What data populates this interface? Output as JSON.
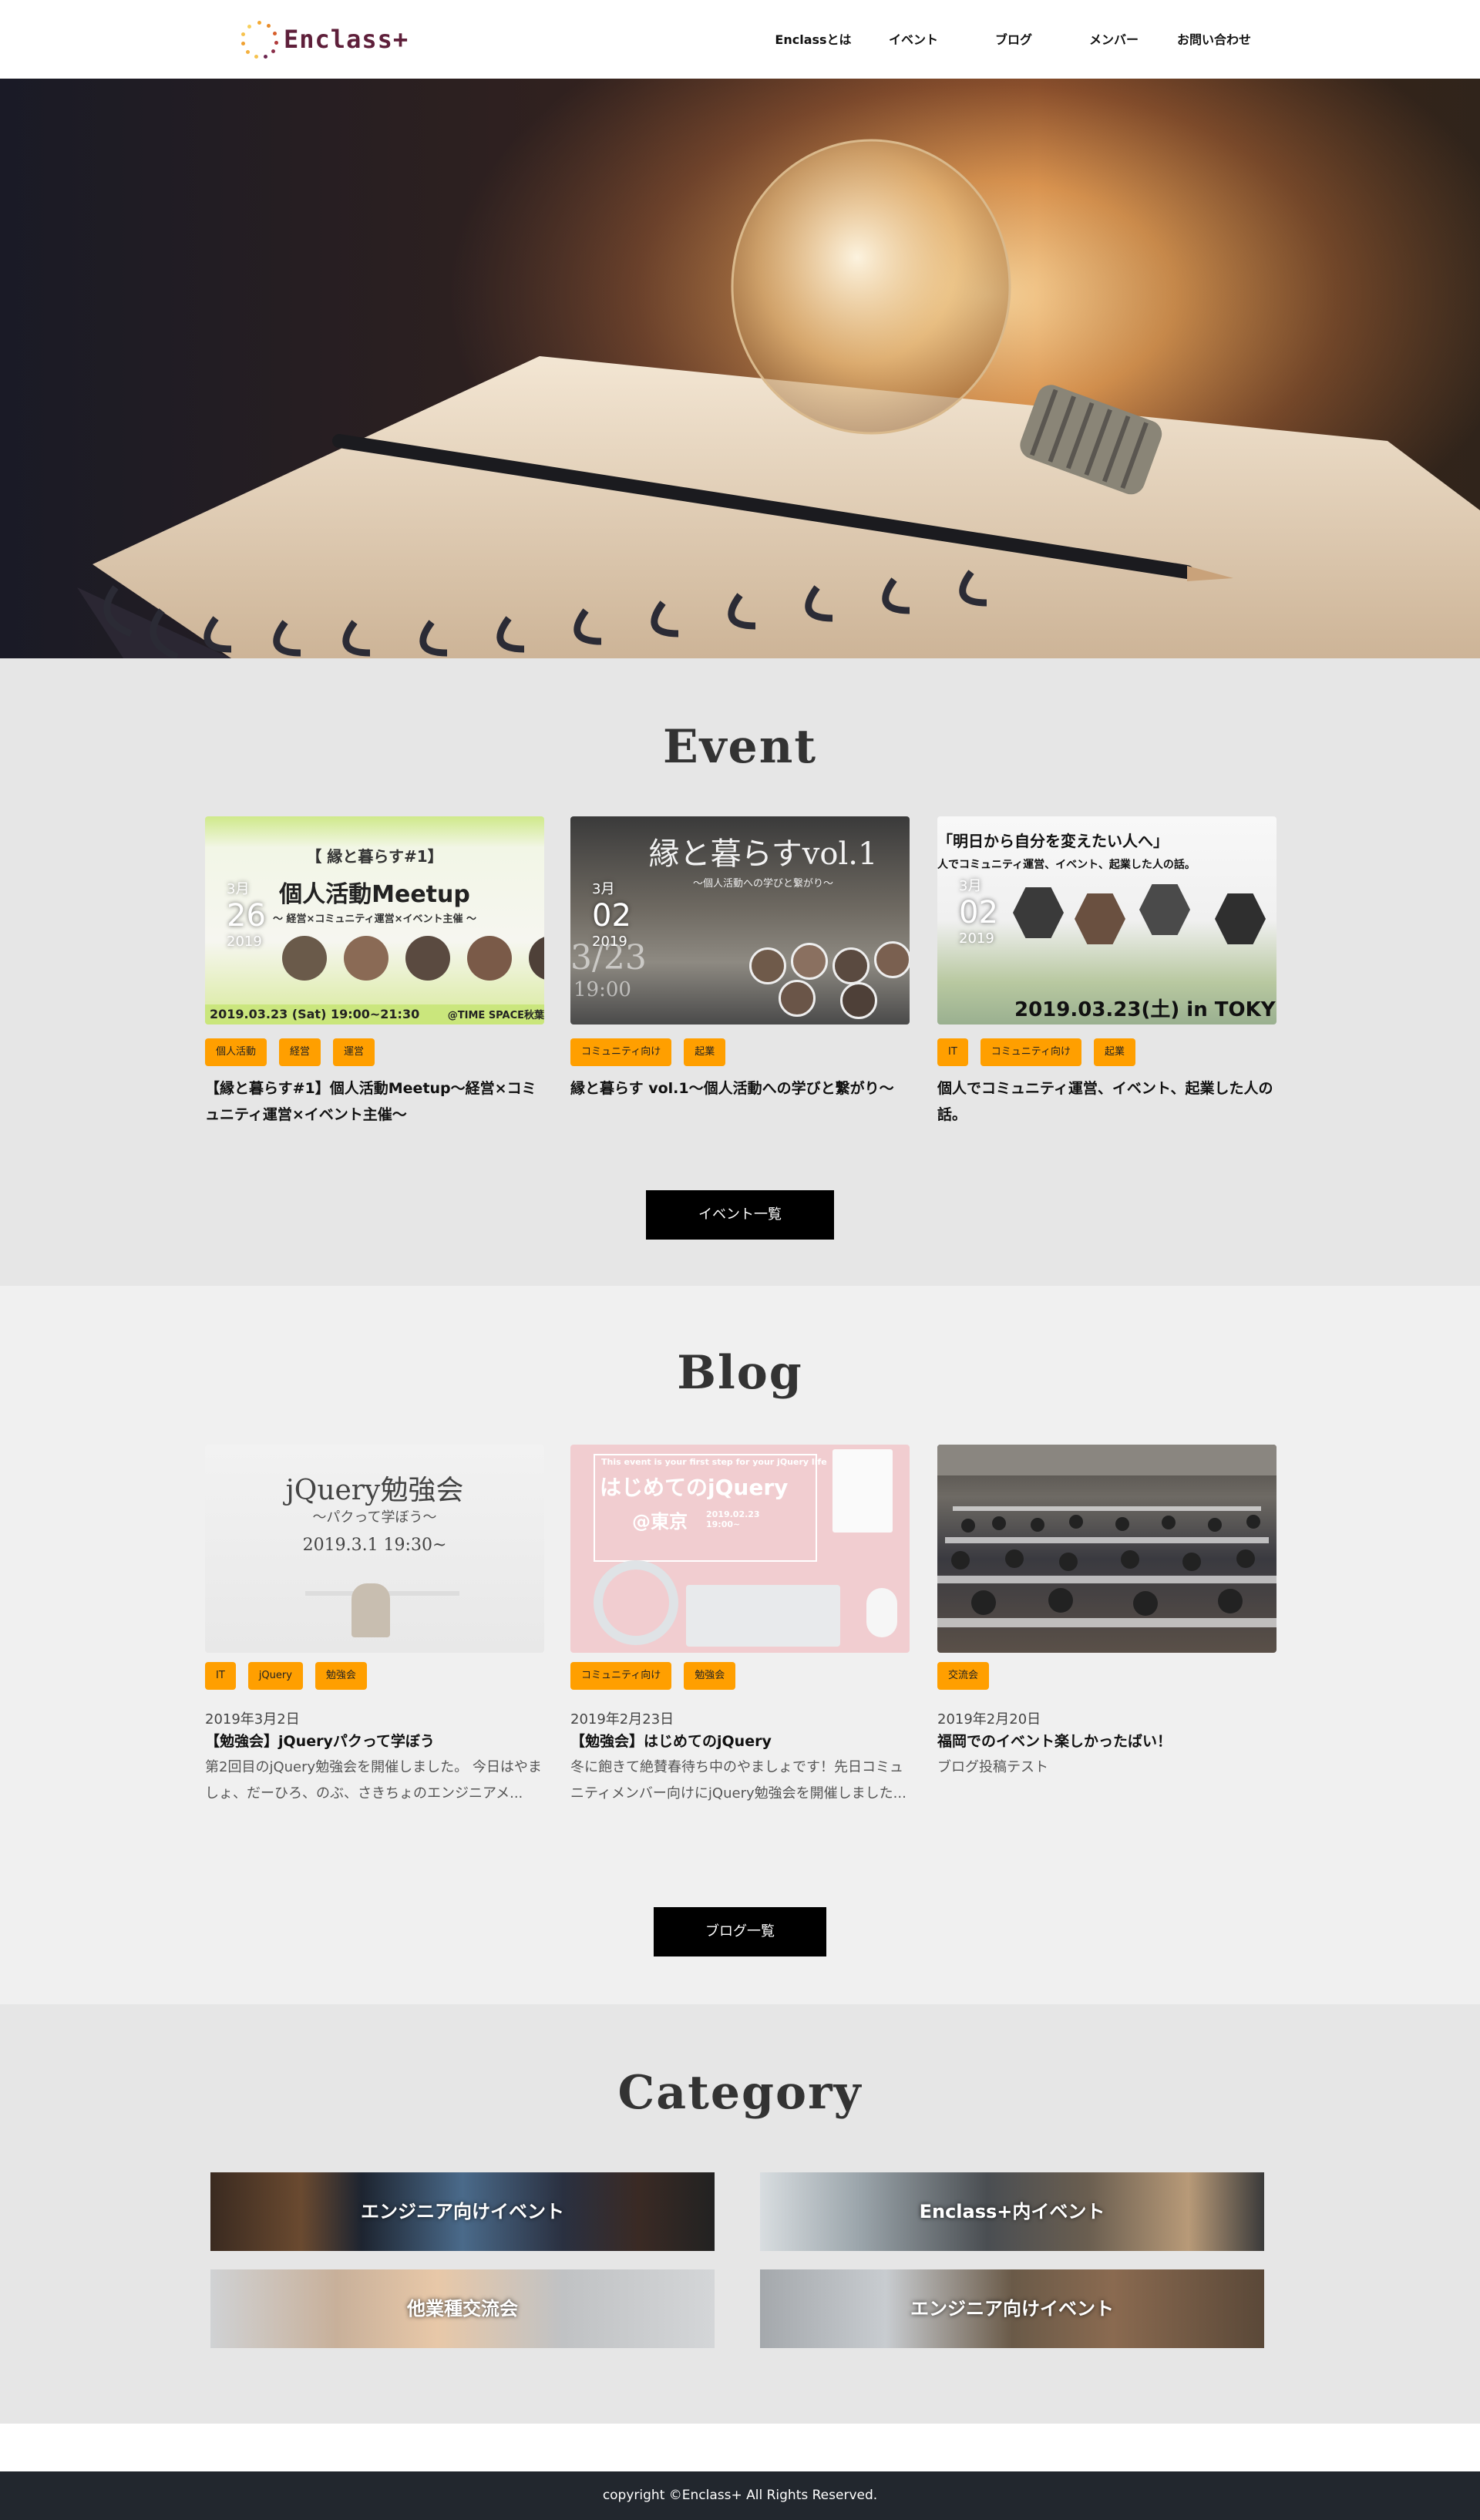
{
  "header": {
    "logo_text": "Enclass+",
    "nav": [
      "Enclassとは",
      "イベント",
      "ブログ",
      "メンバー",
      "お問い合わせ"
    ]
  },
  "event": {
    "title": "Event",
    "cards": [
      {
        "month": "3月",
        "day": "26",
        "year": "2019",
        "thumb_title": "【 縁と暮らす#1】",
        "thumb_headline": "個人活動Meetup",
        "thumb_sub": "〜 経営×コミュニティ運営×イベント主催 〜",
        "thumb_footer": "2019.03.23 (Sat) 19:00~21:30",
        "thumb_venue": "@TIME SPACE秋葉",
        "tags": [
          "個人活動",
          "経営",
          "運営"
        ],
        "title": "【縁と暮らす#1】個人活動Meetup〜経営×コミュニティ運営×イベント主催〜"
      },
      {
        "month": "3月",
        "day": "02",
        "year": "2019",
        "thumb_title": "縁と暮らすvol.1",
        "thumb_sub": "〜個人活動への学びと繋がり〜",
        "thumb_footer": "3/23",
        "thumb_time": "19:00",
        "tags": [
          "コミュニティ向け",
          "起業"
        ],
        "title": "縁と暮らす vol.1〜個人活動への学びと繋がり〜"
      },
      {
        "month": "3月",
        "day": "02",
        "year": "2019",
        "thumb_title": "「明日から自分を変えたい人へ」",
        "thumb_sub": "人でコミュニティ運営、イベント、起業した人の話。",
        "thumb_footer": "2019.03.23(土) in TOKY",
        "tags": [
          "IT",
          "コミュニティ向け",
          "起業"
        ],
        "title": "個人でコミュニティ運営、イベント、起業した人の話。"
      }
    ],
    "more_label": "イベント一覧"
  },
  "blog": {
    "title": "Blog",
    "posts": [
      {
        "thumb_title": "jQuery勉強会",
        "thumb_sub": "〜パクって学ぼう〜",
        "thumb_date": "2019.3.1 19:30~",
        "tags": [
          "IT",
          "jQuery",
          "勉強会"
        ],
        "date": "2019年3月2日",
        "title": "【勉強会】jQueryパクって学ぼう",
        "excerpt": "第2回目のjQuery勉強会を開催しました。 今日はやましょ、だーひろ、のぶ、さきちょのエンジニアメ..."
      },
      {
        "thumb_top": "This event is your first step for your jQuery life",
        "thumb_title": "はじめてのjQuery",
        "thumb_place": "@東京",
        "thumb_date": "2019.02.23 19:00~",
        "tags": [
          "コミュニティ向け",
          "勉強会"
        ],
        "date": "2019年2月23日",
        "title": "【勉強会】はじめてのjQuery",
        "excerpt": "冬に飽きて絶賛春待ち中のやましょです！先日コミュニティメンバー向けにjQuery勉強会を開催しました..."
      },
      {
        "tags": [
          "交流会"
        ],
        "date": "2019年2月20日",
        "title": "福岡でのイベント楽しかったばい！",
        "excerpt": "ブログ投稿テスト"
      }
    ],
    "more_label": "ブログ一覧"
  },
  "category": {
    "title": "Category",
    "items": [
      "エンジニア向けイベント",
      "Enclass+内イベント",
      "他業種交流会",
      "エンジニア向けイベント"
    ]
  },
  "footer": {
    "copyright": "copyright ©Enclass+ All Rights Reserved."
  },
  "colors": {
    "tag": "#ff9f00",
    "logo": "#5e1f3a",
    "footer_bg": "#22272e"
  }
}
